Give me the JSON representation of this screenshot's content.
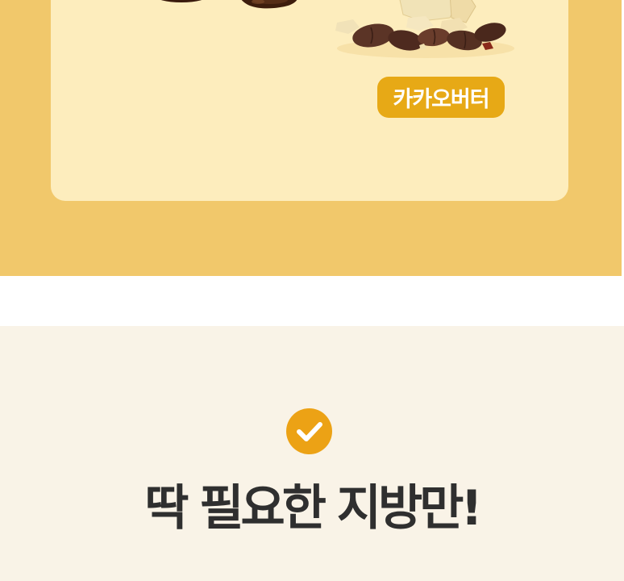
{
  "ingredient_card": {
    "badge_label": "카카오버터",
    "images": [
      "melted-chocolate",
      "cocoa-butter-and-cocoa-beans"
    ]
  },
  "feature": {
    "icon": "check-circle-icon",
    "headline": "딱 필요한 지방만!"
  },
  "colors": {
    "top_background": "#f1c86b",
    "card_background": "#fdedbd",
    "badge": "#e7a916",
    "bottom_background": "#f9f3e7",
    "check_circle": "#eca215",
    "headline_text": "#2f2f2f"
  }
}
